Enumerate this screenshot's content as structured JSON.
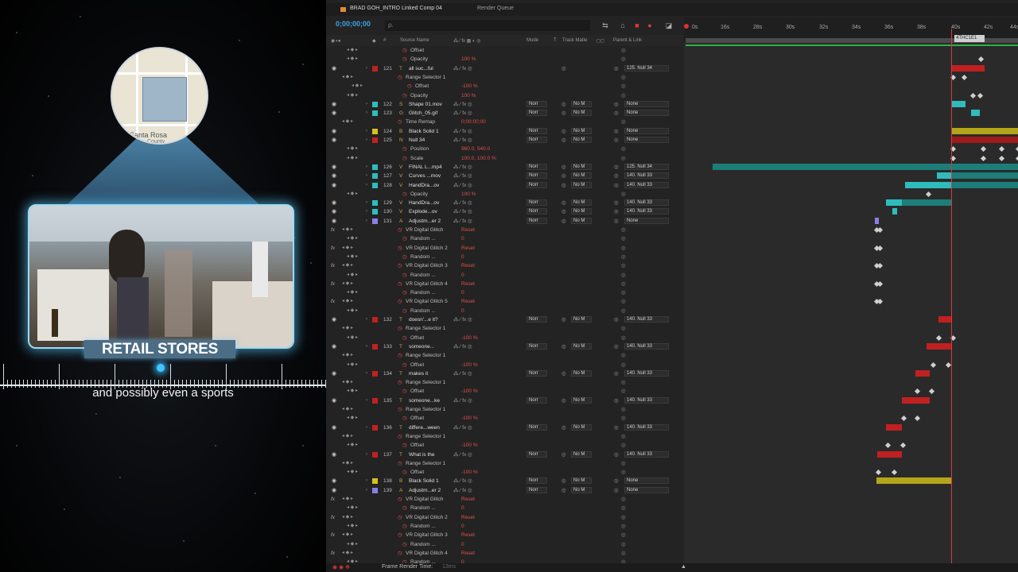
{
  "preview": {
    "map": {
      "labels": [
        "Santa Rosa",
        "County"
      ]
    },
    "retail_label": "RETAIL STORES",
    "caption": "and possibly even a sports"
  },
  "tabs": [
    {
      "label": "BRAD GOH_INTRO Linked Comp 04"
    },
    {
      "label": "Render Queue"
    }
  ],
  "header": {
    "timecode": "0;00;00;00",
    "search_placeholder": "ρ."
  },
  "columns": {
    "source_name": "Source Name",
    "mode": "Mode",
    "t": "T",
    "track_matte": "Track Matte",
    "parent_link": "Parent & Link"
  },
  "ruler": {
    "ticks": [
      "0s",
      "16s",
      "28s",
      "30s",
      "32s",
      "34s",
      "36s",
      "38s",
      "40s",
      "42s",
      "44s"
    ],
    "current_label": "4THC1E1"
  },
  "layers": [
    {
      "kind": "prop",
      "indent": 2,
      "label": "Offset"
    },
    {
      "kind": "prop",
      "indent": 2,
      "label": "Opacity",
      "value": "100 %"
    },
    {
      "kind": "layer",
      "num": "121",
      "color": "#c02020",
      "type": "T",
      "name": "all suc...ful",
      "parent": "125. Null 34"
    },
    {
      "kind": "group",
      "indent": 1,
      "label": "Range Selector 1"
    },
    {
      "kind": "prop",
      "indent": 3,
      "label": "Offset",
      "value": "-100 %"
    },
    {
      "kind": "prop",
      "indent": 2,
      "label": "Opacity",
      "value": "100 %"
    },
    {
      "kind": "layer",
      "num": "122",
      "color": "#2fbcbc",
      "type": "S",
      "name": "Shape 01.mov",
      "mode": "Norr",
      "matte": "No M",
      "parent": "None"
    },
    {
      "kind": "layer",
      "num": "123",
      "color": "#2fbcbc",
      "type": "G",
      "name": "Glitch_05.gif",
      "mode": "Norr",
      "matte": "No M",
      "parent": "None"
    },
    {
      "kind": "prop",
      "indent": 1,
      "label": "Time Remap",
      "value": "0;00;00;00"
    },
    {
      "kind": "layer",
      "num": "124",
      "color": "#d6c11c",
      "type": "B",
      "name": "Black Solid 1",
      "mode": "Norr",
      "matte": "No M",
      "parent": "None"
    },
    {
      "kind": "layer",
      "num": "125",
      "color": "#c02020",
      "type": "N",
      "name": "Null 34",
      "mode": "Norr",
      "matte": "No M",
      "parent": "None"
    },
    {
      "kind": "prop",
      "indent": 2,
      "label": "Position",
      "value": "960.0, 540.0"
    },
    {
      "kind": "prop",
      "indent": 2,
      "label": "Scale",
      "value": "100.0, 100.0 %"
    },
    {
      "kind": "layer",
      "num": "126",
      "color": "#2fbcbc",
      "type": "V",
      "name": "FINAL L...mp4",
      "mode": "Norr",
      "matte": "No M",
      "parent": "125. Null 34"
    },
    {
      "kind": "layer",
      "num": "127",
      "color": "#2fbcbc",
      "type": "V",
      "name": "Curves ...mov",
      "mode": "Norr",
      "matte": "No M",
      "parent": "140. Null 33"
    },
    {
      "kind": "layer",
      "num": "128",
      "color": "#2fbcbc",
      "type": "V",
      "name": "HandDra...ov",
      "mode": "Norr",
      "matte": "No M",
      "parent": "140. Null 33"
    },
    {
      "kind": "prop",
      "indent": 2,
      "label": "Opacity",
      "value": "100 %"
    },
    {
      "kind": "layer",
      "num": "129",
      "color": "#2fbcbc",
      "type": "V",
      "name": "HandDra...ov",
      "mode": "Norr",
      "matte": "No M",
      "parent": "140. Null 33"
    },
    {
      "kind": "layer",
      "num": "130",
      "color": "#2fbcbc",
      "type": "V",
      "name": "Explode...ov",
      "mode": "Norr",
      "matte": "No M",
      "parent": "140. Null 33"
    },
    {
      "kind": "layer",
      "num": "131",
      "color": "#8a7ee6",
      "type": "A",
      "name": "Adjustm...er 2",
      "mode": "Norr",
      "matte": "No M",
      "parent": "None"
    },
    {
      "kind": "effect",
      "indent": 1,
      "label": "VR Digital Glitch",
      "value": "Reset"
    },
    {
      "kind": "prop",
      "indent": 2,
      "label": "Random ...",
      "value": "0"
    },
    {
      "kind": "effect",
      "indent": 1,
      "label": "VR Digital Glitch 2",
      "value": "Reset"
    },
    {
      "kind": "prop",
      "indent": 2,
      "label": "Random ...",
      "value": "0"
    },
    {
      "kind": "effect",
      "indent": 1,
      "label": "VR Digital Glitch 3",
      "value": "Reset"
    },
    {
      "kind": "prop",
      "indent": 2,
      "label": "Random ...",
      "value": "0"
    },
    {
      "kind": "effect",
      "indent": 1,
      "label": "VR Digital Glitch 4",
      "value": "Reset"
    },
    {
      "kind": "prop",
      "indent": 2,
      "label": "Random ...",
      "value": "0"
    },
    {
      "kind": "effect",
      "indent": 1,
      "label": "VR Digital Glitch 5",
      "value": "Reset"
    },
    {
      "kind": "prop",
      "indent": 2,
      "label": "Random ...",
      "value": "0"
    },
    {
      "kind": "layer",
      "num": "132",
      "color": "#c02020",
      "type": "T",
      "name": "doesn'...e it?",
      "mode": "Norr",
      "matte": "No M",
      "parent": "140. Null 33"
    },
    {
      "kind": "group",
      "indent": 1,
      "label": "Range Selector 1"
    },
    {
      "kind": "prop",
      "indent": 2,
      "label": "Offset",
      "value": "-100 %"
    },
    {
      "kind": "layer",
      "num": "133",
      "color": "#c02020",
      "type": "T",
      "name": "someone...",
      "mode": "Norr",
      "matte": "No M",
      "parent": "140. Null 33"
    },
    {
      "kind": "group",
      "indent": 1,
      "label": "Range Selector 1"
    },
    {
      "kind": "prop",
      "indent": 2,
      "label": "Offset",
      "value": "-100 %"
    },
    {
      "kind": "layer",
      "num": "134",
      "color": "#c02020",
      "type": "T",
      "name": "makes it",
      "mode": "Norr",
      "matte": "No M",
      "parent": "140. Null 33"
    },
    {
      "kind": "group",
      "indent": 1,
      "label": "Range Selector 1"
    },
    {
      "kind": "prop",
      "indent": 2,
      "label": "Offset",
      "value": "-100 %"
    },
    {
      "kind": "layer",
      "num": "135",
      "color": "#c02020",
      "type": "T",
      "name": "someone...ke",
      "mode": "Norr",
      "matte": "No M",
      "parent": "140. Null 33"
    },
    {
      "kind": "group",
      "indent": 1,
      "label": "Range Selector 1"
    },
    {
      "kind": "prop",
      "indent": 2,
      "label": "Offset",
      "value": "-100 %"
    },
    {
      "kind": "layer",
      "num": "136",
      "color": "#c02020",
      "type": "T",
      "name": "differe...ween",
      "mode": "Norr",
      "matte": "No M",
      "parent": "140. Null 33"
    },
    {
      "kind": "group",
      "indent": 1,
      "label": "Range Selector 1"
    },
    {
      "kind": "prop",
      "indent": 2,
      "label": "Offset",
      "value": "-100 %"
    },
    {
      "kind": "layer",
      "num": "137",
      "color": "#c02020",
      "type": "T",
      "name": "What is the",
      "mode": "Norr",
      "matte": "No M",
      "parent": "140. Null 33"
    },
    {
      "kind": "group",
      "indent": 1,
      "label": "Range Selector 1"
    },
    {
      "kind": "prop",
      "indent": 2,
      "label": "Offset",
      "value": "-100 %"
    },
    {
      "kind": "layer",
      "num": "138",
      "color": "#d6c11c",
      "type": "B",
      "name": "Black Solid 1",
      "mode": "Norr",
      "matte": "No M",
      "parent": "None"
    },
    {
      "kind": "layer",
      "num": "139",
      "color": "#8a7ee6",
      "type": "A",
      "name": "Adjustm...er 2",
      "mode": "Norr",
      "matte": "No M",
      "parent": "None"
    },
    {
      "kind": "effect",
      "indent": 1,
      "label": "VR Digital Glitch",
      "value": "Reset"
    },
    {
      "kind": "prop",
      "indent": 2,
      "label": "Random ...",
      "value": "0"
    },
    {
      "kind": "effect",
      "indent": 1,
      "label": "VR Digital Glitch 2",
      "value": "Reset"
    },
    {
      "kind": "prop",
      "indent": 2,
      "label": "Random ...",
      "value": "0"
    },
    {
      "kind": "effect",
      "indent": 1,
      "label": "VR Digital Glitch 3",
      "value": "Reset"
    },
    {
      "kind": "prop",
      "indent": 2,
      "label": "Random ...",
      "value": "0"
    },
    {
      "kind": "effect",
      "indent": 1,
      "label": "VR Digital Glitch 4",
      "value": "Reset"
    },
    {
      "kind": "prop",
      "indent": 2,
      "label": "Random ...",
      "value": "0"
    }
  ],
  "footer": {
    "frame_render_label": "Frame Render Time:",
    "frame_render_value": "13ms"
  },
  "colors": {
    "accent_blue": "#3ea2e6",
    "cti_red": "#d83a3a",
    "label_red": "#c02020",
    "label_aqua": "#2fbcbc",
    "label_yellow": "#d6c11c",
    "label_purple": "#8a7ee6"
  }
}
